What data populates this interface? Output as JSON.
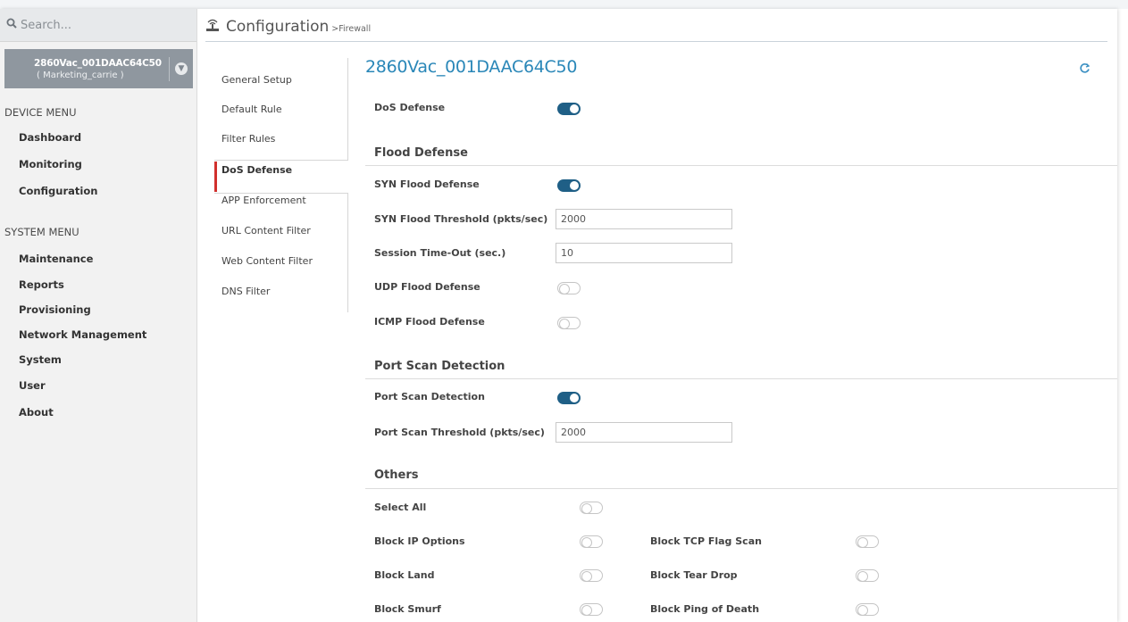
{
  "search": {
    "placeholder": "Search..."
  },
  "device": {
    "name": "2860Vac_001DAAC64C50",
    "profile": "( Marketing_carrie )"
  },
  "device_menu": {
    "heading": "DEVICE MENU",
    "items": [
      "Dashboard",
      "Monitoring",
      "Configuration"
    ]
  },
  "system_menu": {
    "heading": "SYSTEM MENU",
    "items": [
      "Maintenance",
      "Reports",
      "Provisioning",
      "Network Management",
      "System",
      "User",
      "About"
    ]
  },
  "header": {
    "title": "Configuration",
    "breadcrumb": ">Firewall"
  },
  "submenu": {
    "items": [
      "General Setup",
      "Default Rule",
      "Filter Rules",
      "DoS Defense",
      "APP Enforcement",
      "URL Content Filter",
      "Web Content Filter",
      "DNS Filter"
    ],
    "active": "DoS Defense"
  },
  "main": {
    "device_title": "2860Vac_001DAAC64C50",
    "dos_defense": {
      "label": "DoS Defense",
      "enabled": true
    },
    "flood_defense": {
      "heading": "Flood Defense",
      "syn_flood": {
        "label": "SYN Flood Defense",
        "enabled": true
      },
      "syn_threshold": {
        "label": "SYN Flood Threshold (pkts/sec)",
        "value": "2000"
      },
      "session_timeout": {
        "label": "Session Time-Out (sec.)",
        "value": "10"
      },
      "udp_flood": {
        "label": "UDP Flood Defense",
        "enabled": false
      },
      "icmp_flood": {
        "label": "ICMP Flood Defense",
        "enabled": false
      }
    },
    "port_scan": {
      "heading": "Port Scan Detection",
      "detection": {
        "label": "Port Scan Detection",
        "enabled": true
      },
      "threshold": {
        "label": "Port Scan Threshold (pkts/sec)",
        "value": "2000"
      }
    },
    "others": {
      "heading": "Others",
      "select_all": {
        "label": "Select All",
        "enabled": false
      },
      "block_ip_options": {
        "label": "Block IP Options",
        "enabled": false
      },
      "block_tcp_flag_scan": {
        "label": "Block TCP Flag Scan",
        "enabled": false
      },
      "block_land": {
        "label": "Block Land",
        "enabled": false
      },
      "block_tear_drop": {
        "label": "Block Tear Drop",
        "enabled": false
      },
      "block_smurf": {
        "label": "Block Smurf",
        "enabled": false
      },
      "block_ping_of_death": {
        "label": "Block Ping of Death",
        "enabled": false
      }
    }
  },
  "colors": {
    "accent": "#2a87b8",
    "toggle_on": "#1f5f86",
    "active_marker": "#d1302d"
  }
}
